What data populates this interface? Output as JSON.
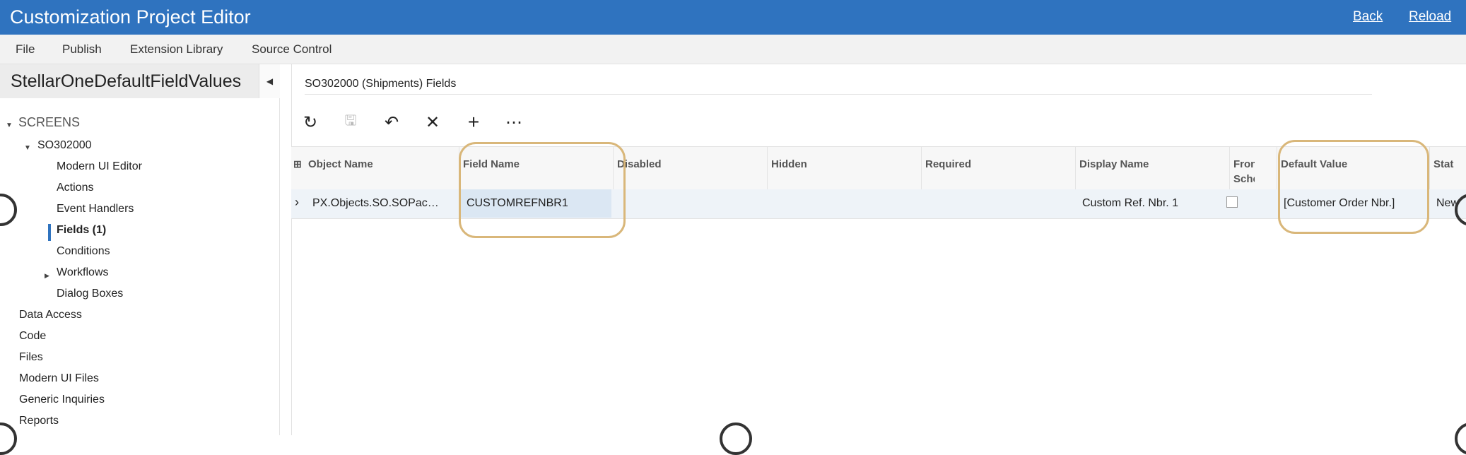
{
  "titlebar": {
    "title": "Customization Project Editor",
    "back": "Back",
    "reload": "Reload",
    "color": "#2f73bf"
  },
  "menu": {
    "items": [
      "File",
      "Publish",
      "Extension Library",
      "Source Control"
    ]
  },
  "sidebar": {
    "project_name": "StellarOneDefaultFieldValues",
    "collapse_icon": "triangle-left-icon",
    "tree": {
      "screens": "SCREENS",
      "screen_id": "SO302000",
      "children": [
        "Modern UI Editor",
        "Actions",
        "Event Handlers",
        "Fields (1)",
        "Conditions",
        "Workflows",
        "Dialog Boxes"
      ],
      "roots": [
        "Data Access",
        "Code",
        "Files",
        "Modern UI Files",
        "Generic Inquiries",
        "Reports"
      ]
    }
  },
  "main": {
    "panel_title": "SO302000 (Shipments) Fields",
    "toolbar_icons": [
      "refresh-icon",
      "save-icon",
      "undo-icon",
      "delete-icon",
      "add-icon",
      "more-icon"
    ],
    "toolbar_glyphs": [
      "↻",
      "🖫",
      "↶",
      "✕",
      "+",
      "⋯"
    ],
    "grid": {
      "columns": [
        "Object Name",
        "Field Name",
        "Disabled",
        "Hidden",
        "Required",
        "Display Name",
        "Fron Sche",
        "Default Value",
        "Stat"
      ],
      "row": {
        "object_name": "PX.Objects.SO.SOPac…",
        "field_name": "CUSTOMREFNBR1",
        "disabled": "",
        "hidden": "",
        "required": "",
        "display_name": "Custom Ref. Nbr. 1",
        "from_schema": false,
        "default_value": "[Customer Order Nbr.]",
        "status": "New"
      }
    }
  },
  "colors": {
    "accent": "#2f73bf",
    "highlight": "#d9b77a"
  }
}
